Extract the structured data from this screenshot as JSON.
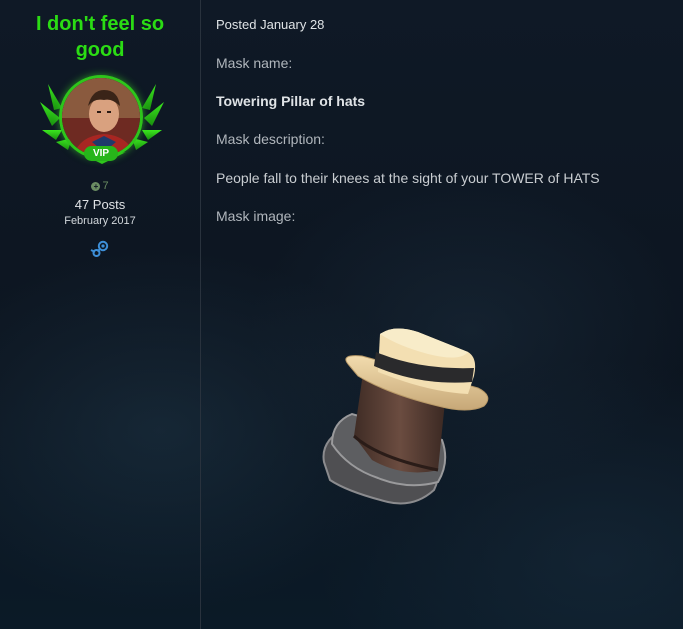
{
  "author": {
    "name": "I don't feel so good",
    "badge": "VIP",
    "reputation": "7",
    "posts": "47 Posts",
    "joined": "February 2017",
    "icons": {
      "reputation": "plus-circle-icon",
      "social": "steam-icon"
    },
    "colors": {
      "name": "#2bdc14",
      "badge": "#27b51a"
    }
  },
  "post": {
    "posted": "Posted January 28",
    "mask_name_label": "Mask name:",
    "mask_name": "Towering Pillar of hats",
    "mask_description_label": "Mask description:",
    "mask_description": "People fall to their knees at the sight of your TOWER of HATS",
    "mask_image_label": "Mask image:",
    "image_subject": "stacked-hats-image"
  }
}
